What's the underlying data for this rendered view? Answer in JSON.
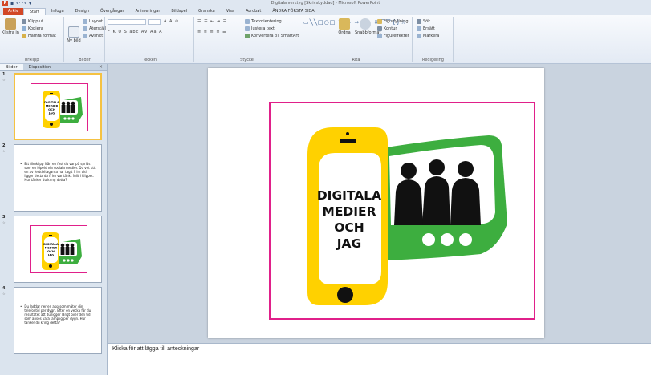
{
  "window": {
    "title": "Digitala verktyg [Skrivskyddad] - Microsoft PowerPoint",
    "app_icon": "P"
  },
  "quick_access": [
    "save-icon",
    "undo-icon",
    "redo-icon"
  ],
  "ribbon_tabs": [
    "Arkiv",
    "Start",
    "Infoga",
    "Design",
    "Övergångar",
    "Animeringar",
    "Bildspel",
    "Granska",
    "Visa",
    "Acrobat",
    "ÄNDRA FÖRSTA SIDA"
  ],
  "ribbon": {
    "clipboard": {
      "paste": "Klistra in",
      "cut": "Klipp ut",
      "copy": "Kopiera",
      "format_painter": "Hämta format",
      "label": "Urklipp"
    },
    "slides": {
      "new_slide": "Ny bild",
      "layout": "Layout",
      "reset": "Återställ",
      "section": "Avsnitt",
      "label": "Bilder"
    },
    "font": {
      "label": "Tecken"
    },
    "paragraph": {
      "text_direction": "Textorientering",
      "align_text": "Justera text",
      "smartart": "Konvertera till SmartArt",
      "label": "Stycke"
    },
    "drawing": {
      "arrange": "Ordna",
      "quick_styles": "Snabbformat",
      "shape_fill": "Figurfyllning",
      "shape_outline": "Kontur",
      "shape_effects": "Figureffekter",
      "label": "Rita"
    },
    "editing": {
      "find": "Sök",
      "replace": "Ersätt",
      "select": "Markera",
      "label": "Redigering"
    }
  },
  "pane": {
    "tabs": [
      "Bilder",
      "Disposition"
    ],
    "close": "×"
  },
  "slides": [
    {
      "number": "1",
      "star": "☆",
      "type": "illustration",
      "title_lines": [
        "DIGITALA",
        "MEDIER",
        "OCH",
        "JAG"
      ]
    },
    {
      "number": "2",
      "star": "☆",
      "type": "text",
      "bullet": "Ett filmklipp från en fest du var på sprids som en löpeld via sociala medier. Du vet att en av festdeltagarna har tagit fi lm vid ligger detta då fi lm var tänkt fullt i klippet. Hur tänker du kring detta?"
    },
    {
      "number": "3",
      "star": "☆",
      "type": "illustration",
      "title_lines": [
        "DIGITALA",
        "MEDIER",
        "OCH",
        "JAG"
      ]
    },
    {
      "number": "4",
      "star": "☆",
      "type": "text",
      "bullet": "Du laddar ner en app som mäter din telefontid per dygn. Efter en vecka får du resultatet att du ligger långt över den tid som anses vara lämplig per dygn. Hur tänker du kring detta?"
    }
  ],
  "main_slide": {
    "title_lines": [
      "DIGITALA",
      "MEDIER",
      "OCH",
      "JAG"
    ]
  },
  "notes": {
    "placeholder": "Klicka för att lägga till anteckningar"
  },
  "colors": {
    "yellow": "#FFD100",
    "green": "#3DAE3F",
    "magenta": "#E0208A",
    "file_tab": "#D24726"
  }
}
